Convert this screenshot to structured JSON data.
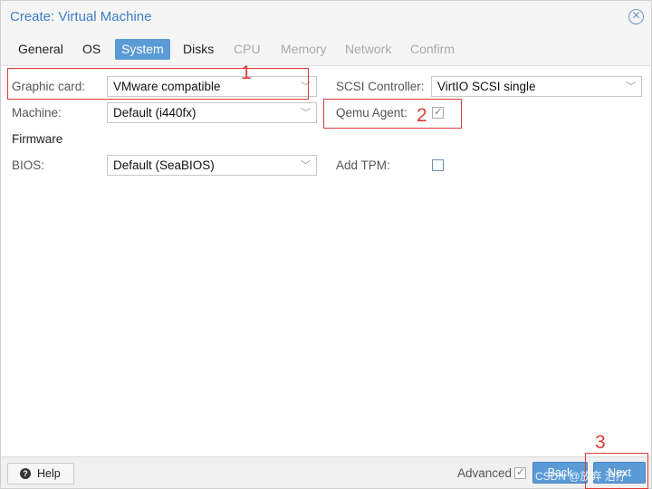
{
  "window": {
    "title": "Create: Virtual Machine"
  },
  "tabs": [
    {
      "label": "General",
      "state": "normal"
    },
    {
      "label": "OS",
      "state": "normal"
    },
    {
      "label": "System",
      "state": "active"
    },
    {
      "label": "Disks",
      "state": "normal"
    },
    {
      "label": "CPU",
      "state": "disabled"
    },
    {
      "label": "Memory",
      "state": "disabled"
    },
    {
      "label": "Network",
      "state": "disabled"
    },
    {
      "label": "Confirm",
      "state": "disabled"
    }
  ],
  "form": {
    "graphic_card": {
      "label": "Graphic card:",
      "value": "VMware compatible"
    },
    "scsi_controller": {
      "label": "SCSI Controller:",
      "value": "VirtIO SCSI single"
    },
    "machine": {
      "label": "Machine:",
      "value": "Default (i440fx)"
    },
    "qemu_agent": {
      "label": "Qemu Agent:",
      "checked": true
    },
    "firmware_heading": "Firmware",
    "bios": {
      "label": "BIOS:",
      "value": "Default (SeaBIOS)"
    },
    "add_tpm": {
      "label": "Add TPM:",
      "checked": false
    }
  },
  "footer": {
    "help_label": "Help",
    "advanced_label": "Advanced",
    "advanced_checked": true,
    "back_label": "Back",
    "next_label": "Next"
  },
  "annotations": [
    "1",
    "2",
    "3"
  ],
  "watermark": "CSDN @放弃   治疗",
  "colors": {
    "accent": "#5b9bd5",
    "title": "#3d7ec6",
    "annotation": "#e03a3a"
  }
}
